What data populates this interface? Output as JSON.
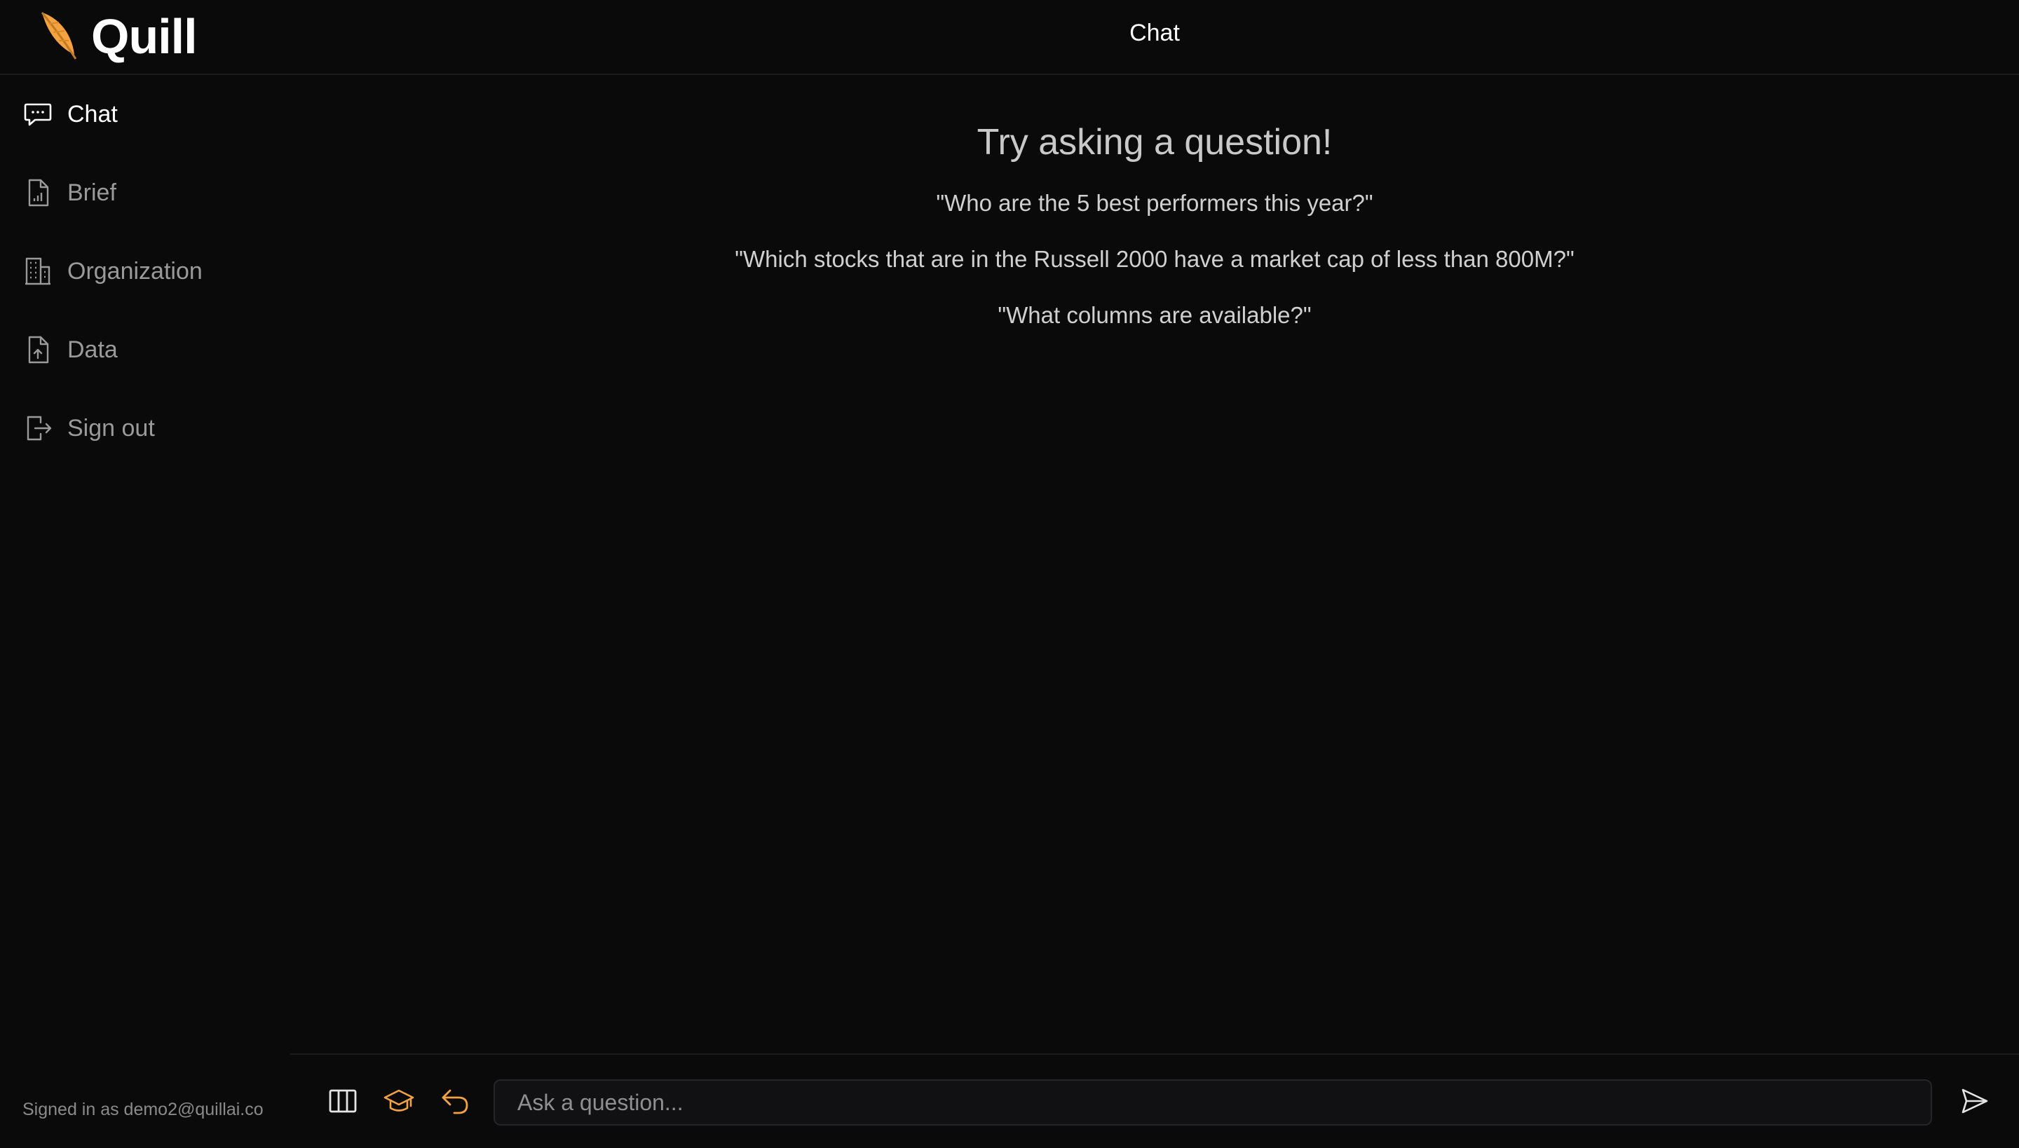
{
  "app": {
    "name": "Quill",
    "page_title": "Chat",
    "accent_color": "#f4a340"
  },
  "sidebar": {
    "items": [
      {
        "label": "Chat",
        "icon": "chat-bubble-icon",
        "active": true
      },
      {
        "label": "Brief",
        "icon": "document-chart-icon",
        "active": false
      },
      {
        "label": "Organization",
        "icon": "building-icon",
        "active": false
      },
      {
        "label": "Data",
        "icon": "document-upload-icon",
        "active": false
      },
      {
        "label": "Sign out",
        "icon": "sign-out-icon",
        "active": false
      }
    ],
    "signed_in_text": "Signed in as demo2@quillai.co"
  },
  "main": {
    "prompt_title": "Try asking a question!",
    "suggestions": [
      "\"Who are the 5 best performers this year?\"",
      "\"Which stocks that are in the Russell 2000 have a market cap of less than 800M?\"",
      "\"What columns are available?\""
    ]
  },
  "composer": {
    "placeholder": "Ask a question...",
    "value": "",
    "tools": [
      "columns-icon",
      "graduation-cap-icon",
      "undo-arrow-icon"
    ],
    "send_icon": "send-icon"
  }
}
